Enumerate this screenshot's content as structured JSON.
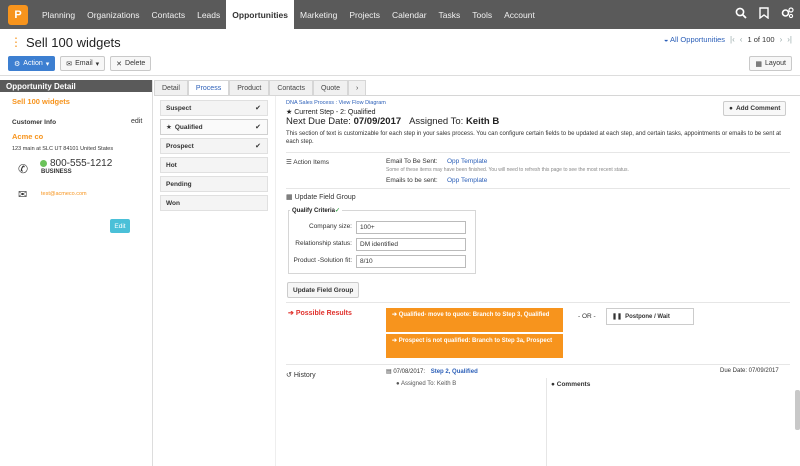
{
  "nav": {
    "logo": "P",
    "items": [
      "Planning",
      "Organizations",
      "Contacts",
      "Leads",
      "Opportunities",
      "Marketing",
      "Projects",
      "Calendar",
      "Tasks",
      "Tools",
      "Account"
    ],
    "active": "Opportunities",
    "icons": [
      "search-icon",
      "bookmark-icon",
      "settings-icon"
    ]
  },
  "page": {
    "title": "Sell 100 widgets"
  },
  "pager": {
    "all_label": "All Opportunities",
    "position": "1 of 100"
  },
  "toolbar": {
    "action": "Action",
    "email": "Email",
    "delete": "Delete",
    "layout": "Layout"
  },
  "left": {
    "header": "Opportunity Detail",
    "opp_name": "Sell 100 widgets",
    "customer_info": "Customer Info",
    "edit_link": "edit",
    "company": "Acme co",
    "address": "123 main at SLC UT 84101 United States",
    "phone": "800-555-1212",
    "phone_type": "BUSINESS",
    "email": "test@acmeco.com",
    "edit_button": "Edit"
  },
  "tabs": [
    "Detail",
    "Process",
    "Product",
    "Contacts",
    "Quote",
    "›"
  ],
  "active_tab": "Process",
  "stages": [
    {
      "label": "Suspect",
      "check": "✔"
    },
    {
      "label": "Qualified",
      "check": "✔",
      "star": "★"
    },
    {
      "label": "Prospect",
      "check": "✔"
    },
    {
      "label": "Hot",
      "check": ""
    },
    {
      "label": "Pending",
      "check": ""
    },
    {
      "label": "Won",
      "check": ""
    }
  ],
  "process": {
    "links": "DNA Sales Process : View Flow Diagram",
    "add_comment": "Add Comment",
    "current_step": "Current Step - 2: Qualified",
    "next_due_label": "Next Due Date:",
    "next_due_value": "07/09/2017",
    "assigned_label": "Assigned To:",
    "assigned_value": "Keith B",
    "description": "This section of text is customizable for each step in your sales process. You can configure certain fields to be updated at each step, and certain tasks, appointments or emails to be sent at each step."
  },
  "action_items": {
    "label": "Action Items",
    "email_to_send_label": "Email To Be Sent:",
    "email_to_send_value": "Opp Template",
    "note": "Some of these items may have been finished. You will need to refresh this page to see the most recent status.",
    "emails_sent_label": "Emails to be sent:",
    "emails_sent_value": "Opp Template"
  },
  "field_group": {
    "title": "Update Field Group",
    "criteria": "Qualify Criteria",
    "fields": [
      {
        "label": "Company size:",
        "value": "100+"
      },
      {
        "label": "Relationship status:",
        "value": "DM identified"
      },
      {
        "label": "Product -Solution fit:",
        "value": "8/10"
      }
    ],
    "button": "Update Field Group"
  },
  "results": {
    "label": "Possible Results",
    "options": [
      "Qualified- move to quote: Branch to Step 3, Qualified",
      "Prospect is not qualified: Branch to Step 3a, Prospect"
    ],
    "or_label": "- OR -",
    "postpone": "Postpone / Wait"
  },
  "history": {
    "label": "History",
    "date": "07/08/2017:",
    "step": "Step 2, Qualified",
    "due": "Due Date: 07/09/2017",
    "assigned": "Assigned To: Keith B",
    "comments": "Comments"
  },
  "colors": {
    "accent": "#f7941d",
    "nav_bg": "#5a5a5a",
    "link": "#2b5fb8",
    "primary_btn": "#3d7fd1"
  }
}
